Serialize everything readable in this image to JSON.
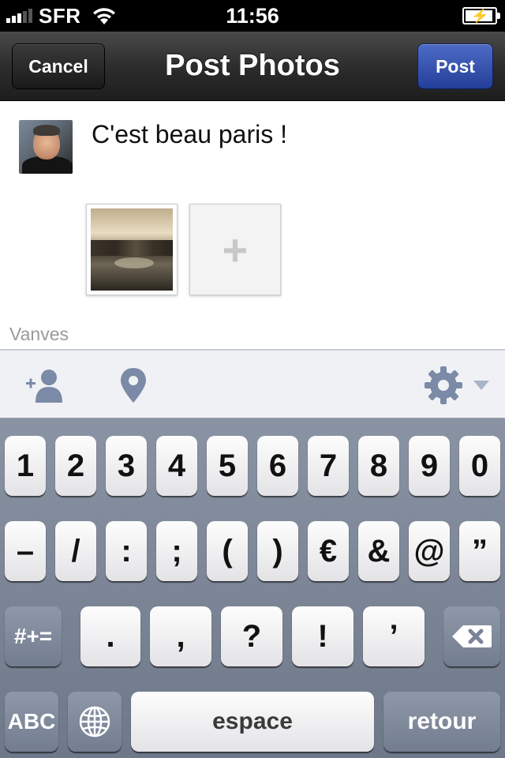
{
  "status_bar": {
    "carrier": "SFR",
    "time": "11:56"
  },
  "nav": {
    "cancel_label": "Cancel",
    "title": "Post Photos",
    "post_label": "Post"
  },
  "composer": {
    "text": "C'est beau paris !",
    "location": "Vanves",
    "add_photo_glyph": "+"
  },
  "toolbar": {
    "icons": [
      "tag-friend-icon",
      "location-pin-icon",
      "gear-icon",
      "dropdown-arrow-icon"
    ]
  },
  "keyboard": {
    "row1": [
      "1",
      "2",
      "3",
      "4",
      "5",
      "6",
      "7",
      "8",
      "9",
      "0"
    ],
    "row2": [
      "–",
      "/",
      ":",
      ";",
      "(",
      ")",
      "€",
      "&",
      "@",
      "”"
    ],
    "row3": {
      "shift": "#+=",
      "keys": [
        ".",
        ",",
        "?",
        "!",
        "’"
      ]
    },
    "row4": {
      "abc": "ABC",
      "space": "espace",
      "return": "retour"
    }
  },
  "colors": {
    "post_button": "#2f4fb0",
    "nav_bar": "#2d2d2d",
    "keyboard": "#7a8496"
  }
}
